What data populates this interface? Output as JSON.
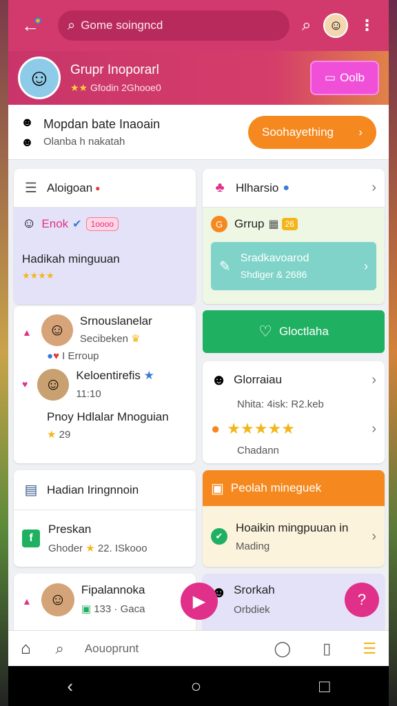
{
  "topbar": {
    "search_placeholder": "Gome soingncd"
  },
  "group": {
    "title": "Grupr Inoporarl",
    "subtitle": "Gfodin 2Ghooe0",
    "button_label": "Oolb"
  },
  "strip": {
    "title": "Mopdan bate Inaoain",
    "subtitle": "Olanba h nakatah",
    "button_label": "Soohayething"
  },
  "left": {
    "card1": {
      "title": "Aloigoan",
      "pill_name": "Enok",
      "badge": "1oooo",
      "body": "Hadikah minguuan"
    },
    "card2": {
      "person1_name": "Srnouslanelar",
      "person1_sub": "Secibeken",
      "person1_meta": "I Erroup",
      "person2_name": "Keloentirefis",
      "person2_time": "11:10",
      "body": "Pnoy Hdlalar Mnoguian",
      "count": "29"
    },
    "card3": {
      "title": "Hadian Iringnnoin"
    },
    "card4": {
      "title": "Preskan",
      "sub": "Ghoder",
      "sub2": "22. ISkooo"
    },
    "card5": {
      "name": "Fipalannoka",
      "sub": "133 · Gaca"
    }
  },
  "right": {
    "card1": {
      "title": "Hlharsio",
      "group_label": "Grrup",
      "group_badge": "26",
      "tile_title": "Sradkavoarod",
      "tile_sub": "Shdiger & 2686"
    },
    "heart_button_label": "Gloctlaha",
    "card2": {
      "name": "Glorraiau",
      "sub": "Nhita: 4isk: R2.keb",
      "footer": "Chadann"
    },
    "card3": {
      "header": "Peolah mineguek",
      "title": "Hoaikin mingpuuan in",
      "sub": "Mading"
    },
    "card4": {
      "name": "Srorkah",
      "sub": "Orbdiek"
    }
  },
  "bottomnav": {
    "search_label": "Aouoprunt"
  },
  "colors": {
    "primary": "#d23a6e",
    "orange": "#f5891f",
    "green": "#1fb062",
    "magenta": "#f04fd8",
    "lavender": "#e4e2f8",
    "teal": "#7fd3c9"
  }
}
